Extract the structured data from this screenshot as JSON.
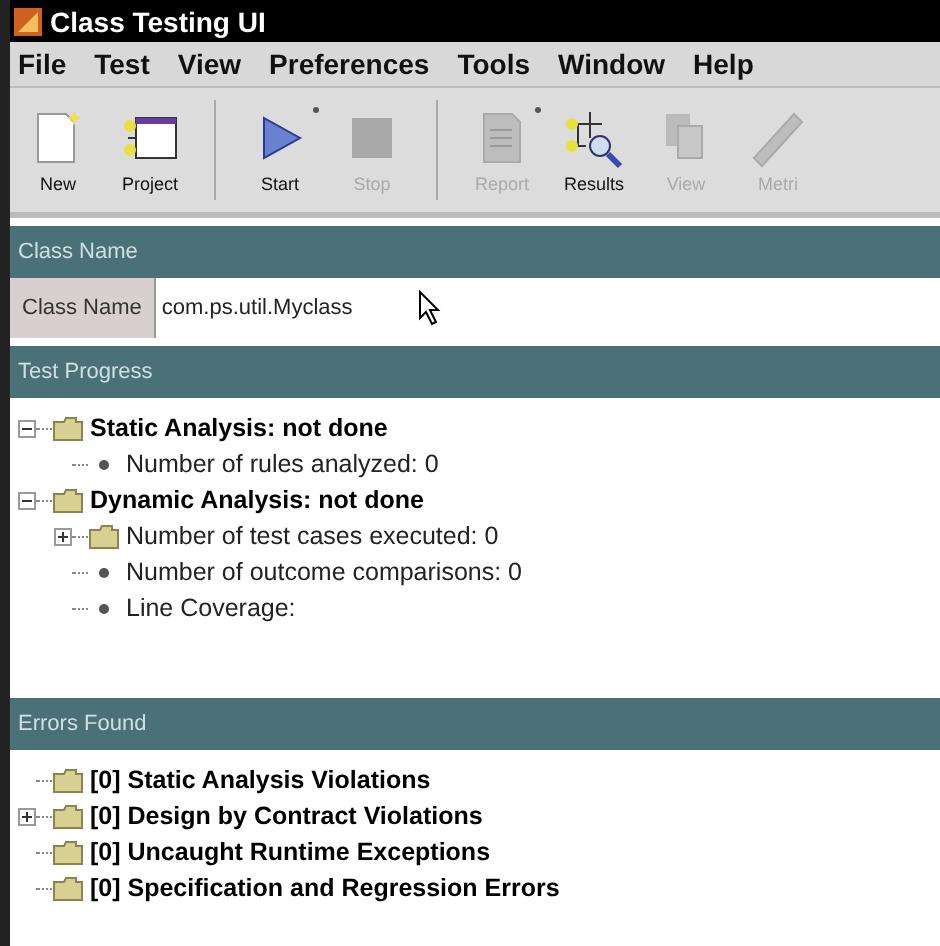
{
  "window": {
    "title": "Class Testing UI"
  },
  "menu": [
    "File",
    "Test",
    "View",
    "Preferences",
    "Tools",
    "Window",
    "Help"
  ],
  "toolbar": {
    "groups": [
      [
        {
          "kind": "new",
          "label": "New",
          "disabled": false,
          "dropdown": false
        },
        {
          "kind": "project",
          "label": "Project",
          "disabled": false,
          "dropdown": false
        }
      ],
      [
        {
          "kind": "start",
          "label": "Start",
          "disabled": false,
          "dropdown": true
        },
        {
          "kind": "stop",
          "label": "Stop",
          "disabled": true,
          "dropdown": false
        }
      ],
      [
        {
          "kind": "report",
          "label": "Report",
          "disabled": true,
          "dropdown": true
        },
        {
          "kind": "results",
          "label": "Results",
          "disabled": false,
          "dropdown": false
        },
        {
          "kind": "view",
          "label": "View",
          "disabled": true,
          "dropdown": false
        },
        {
          "kind": "metrics",
          "label": "Metri",
          "disabled": true,
          "dropdown": false
        }
      ]
    ]
  },
  "class_name": {
    "header": "Class Name",
    "label": "Class Name",
    "value": "com.ps.util.Myclass"
  },
  "test_progress": {
    "header": "Test Progress",
    "tree": [
      {
        "kind": "folder",
        "label": "Static Analysis: not done",
        "expanded": true,
        "children": [
          {
            "kind": "leaf",
            "label": "Number of rules analyzed: 0"
          }
        ]
      },
      {
        "kind": "folder",
        "label": "Dynamic Analysis: not done",
        "expanded": true,
        "children": [
          {
            "kind": "folder",
            "label": "Number of test cases executed: 0",
            "expanded": false
          },
          {
            "kind": "leaf",
            "label": "Number of outcome comparisons: 0"
          },
          {
            "kind": "leaf",
            "label": "Line Coverage:"
          }
        ]
      }
    ]
  },
  "errors_found": {
    "header": "Errors Found",
    "tree": [
      {
        "kind": "folder",
        "label": "[0] Static Analysis Violations"
      },
      {
        "kind": "folder",
        "label": "[0] Design by Contract Violations",
        "expanded": false
      },
      {
        "kind": "folder",
        "label": "[0] Uncaught Runtime Exceptions"
      },
      {
        "kind": "folder",
        "label": "[0] Specification and Regression Errors"
      }
    ]
  }
}
